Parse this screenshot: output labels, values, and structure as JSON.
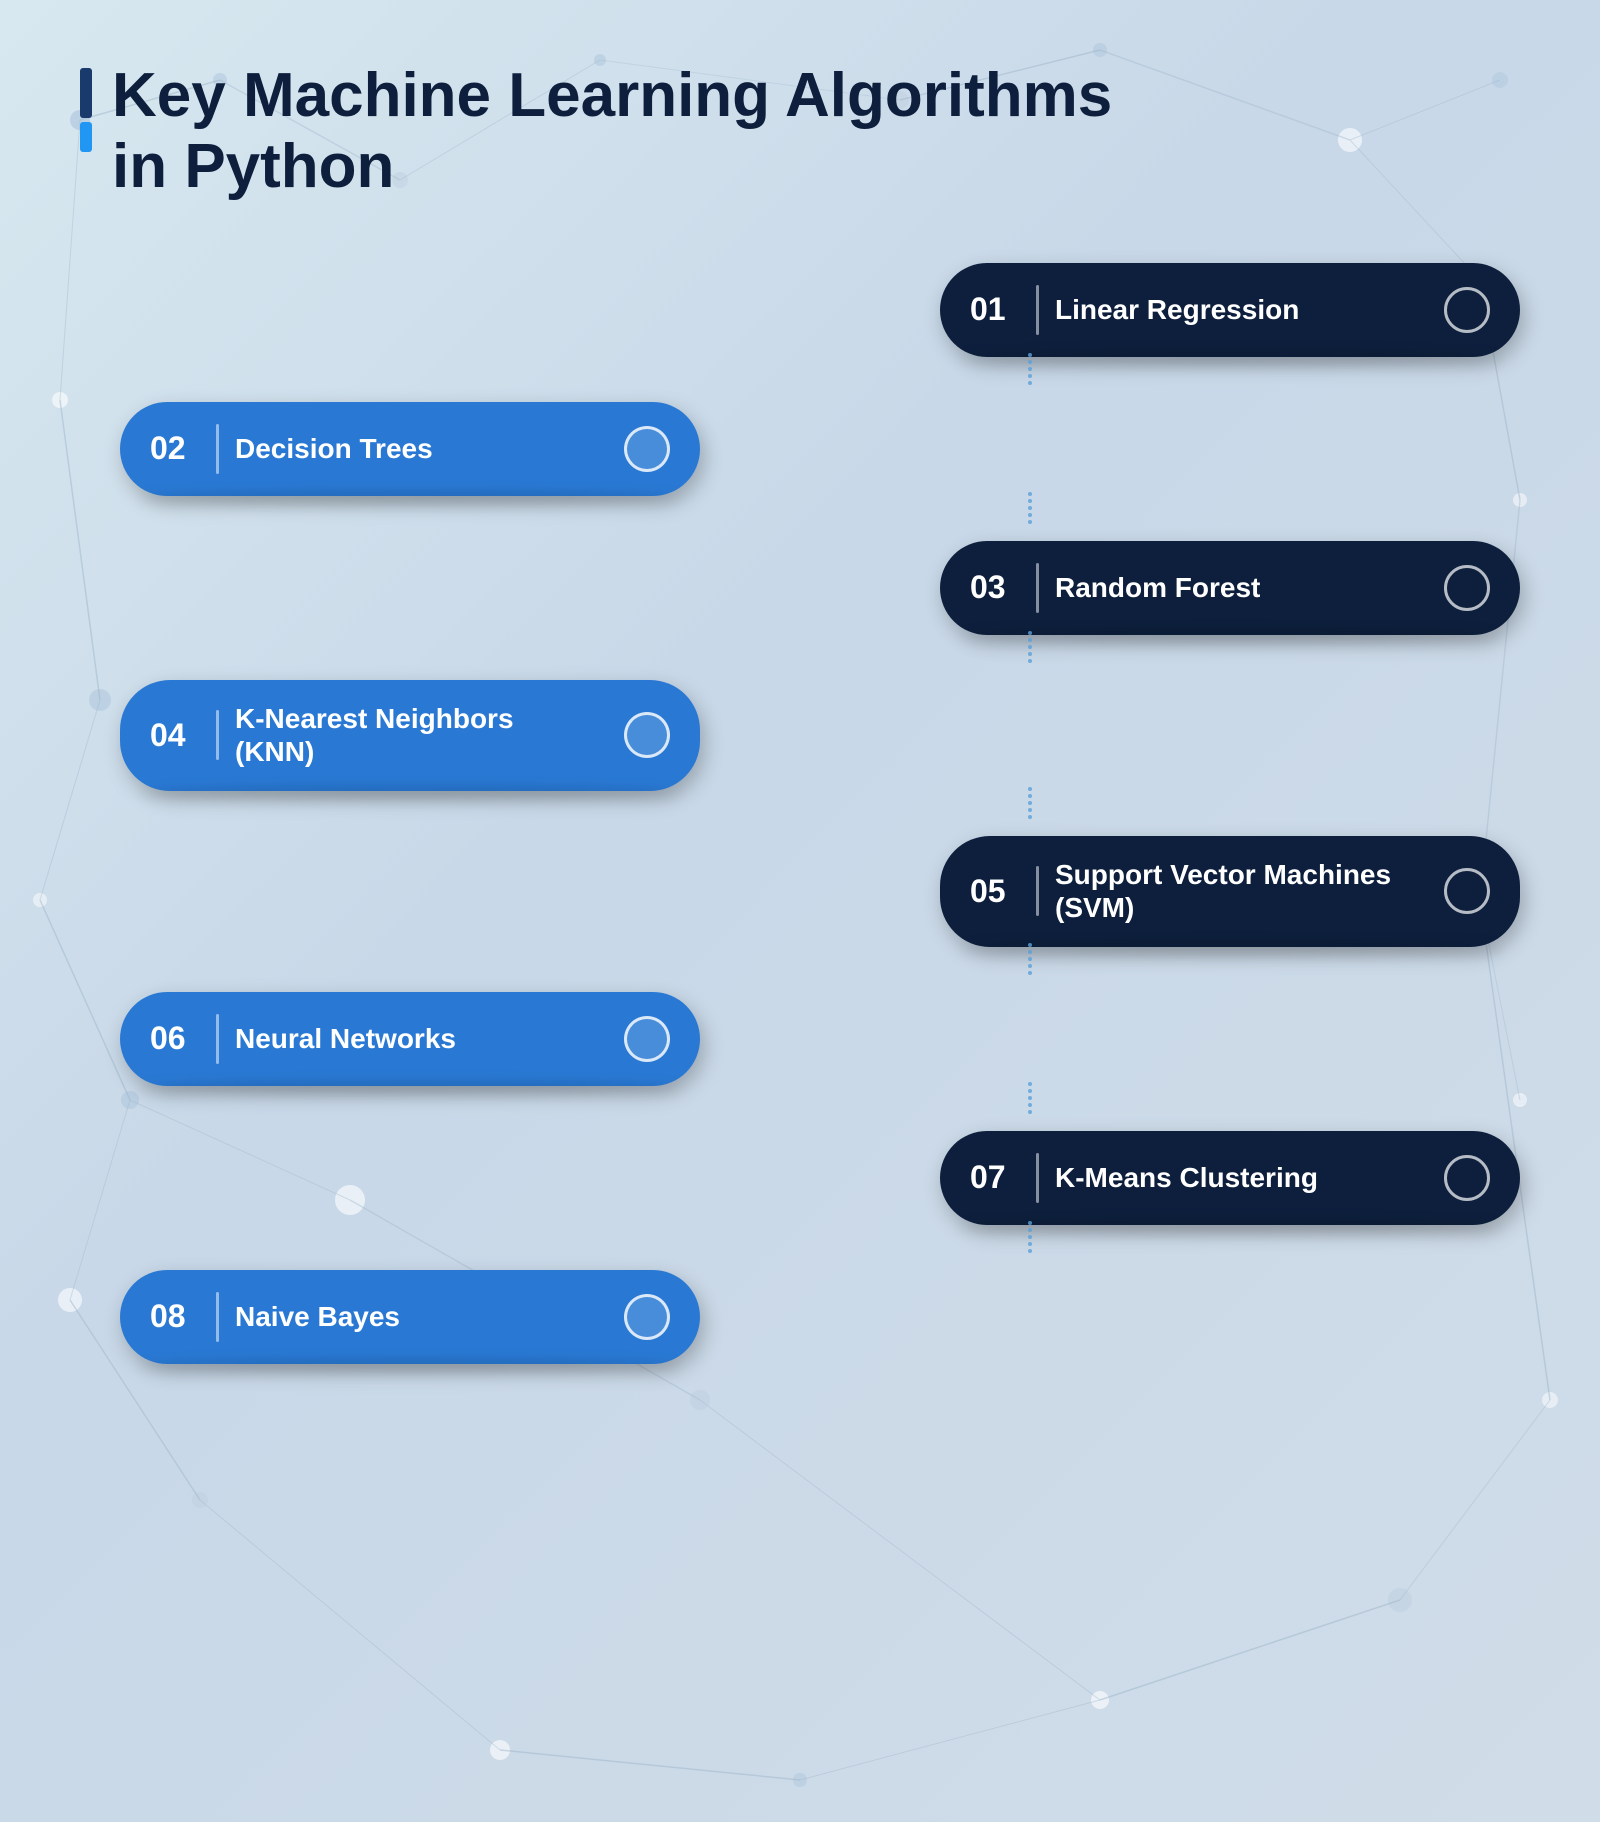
{
  "title": {
    "line1": "Key Machine Learning Algorithms",
    "line2": "in Python"
  },
  "algorithms": [
    {
      "id": "01",
      "label": "Linear Regression",
      "side": "dark"
    },
    {
      "id": "02",
      "label": "Decision Trees",
      "side": "light"
    },
    {
      "id": "03",
      "label": "Random Forest",
      "side": "dark"
    },
    {
      "id": "04",
      "label": "K-Nearest Neighbors\n(KNN)",
      "side": "light"
    },
    {
      "id": "05",
      "label": "Support Vector Machines\n(SVM)",
      "side": "dark"
    },
    {
      "id": "06",
      "label": "Neural Networks",
      "side": "light"
    },
    {
      "id": "07",
      "label": "K-Means Clustering",
      "side": "dark"
    },
    {
      "id": "08",
      "label": "Naive Bayes",
      "side": "light"
    }
  ]
}
